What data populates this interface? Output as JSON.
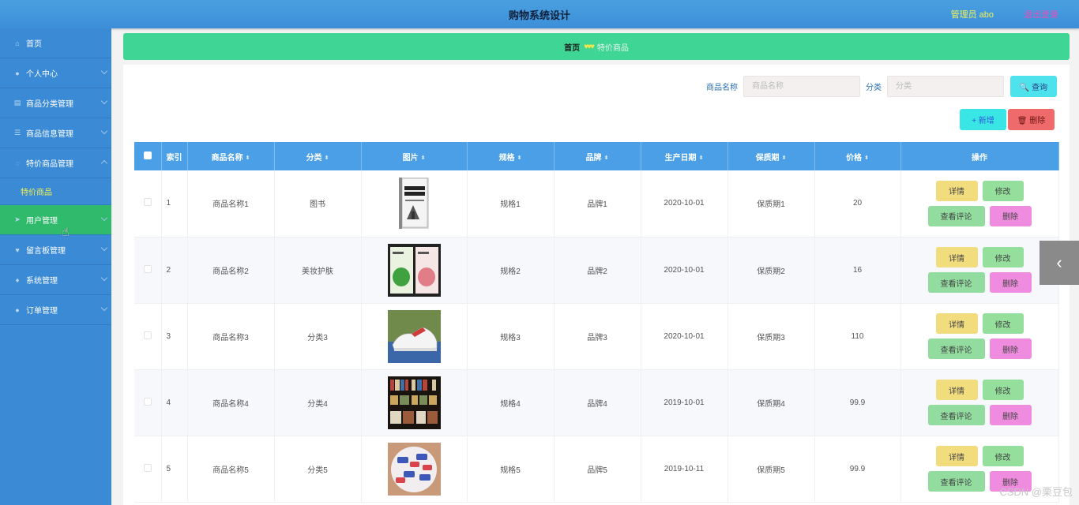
{
  "header": {
    "title": "购物系统设计",
    "user": "管理员 abo",
    "logout": "退出登录"
  },
  "sidebar": {
    "items": [
      {
        "label": "首页",
        "icon": "home-icon",
        "glyph": "⌂"
      },
      {
        "label": "个人中心",
        "icon": "user-icon",
        "glyph": "●"
      },
      {
        "label": "商品分类管理",
        "icon": "clipboard-icon",
        "glyph": "▤"
      },
      {
        "label": "商品信息管理",
        "icon": "list-icon",
        "glyph": "☰"
      },
      {
        "label": "特价商品管理",
        "icon": "settings-icon",
        "glyph": "◌"
      },
      {
        "label": "用户管理",
        "icon": "send-icon",
        "glyph": "➤"
      },
      {
        "label": "留言板管理",
        "icon": "heart-icon",
        "glyph": "♥"
      },
      {
        "label": "系统管理",
        "icon": "mic-icon",
        "glyph": "♦"
      },
      {
        "label": "订单管理",
        "icon": "location-icon",
        "glyph": "●"
      }
    ],
    "submenu": "特价商品"
  },
  "breadcrumb": {
    "home": "首页",
    "separator": "♥♥♥",
    "current": "特价商品"
  },
  "search": {
    "name_label": "商品名称",
    "name_placeholder": "商品名称",
    "category_label": "分类",
    "category_placeholder": "分类",
    "query_button": "🔍 查询"
  },
  "actions": {
    "add": "+ 新增",
    "delete": "🗑 删除"
  },
  "table": {
    "headers": [
      "索引",
      "商品名称",
      "分类",
      "图片",
      "规格",
      "品牌",
      "生产日期",
      "保质期",
      "价格",
      "操作"
    ],
    "rows": [
      {
        "index": "1",
        "name": "商品名称1",
        "category": "图书",
        "spec": "规格1",
        "brand": "品牌1",
        "date": "2020-10-01",
        "shelf": "保质期1",
        "price": "20",
        "image": "book-cover"
      },
      {
        "index": "2",
        "name": "商品名称2",
        "category": "美妆护肤",
        "spec": "规格2",
        "brand": "品牌2",
        "date": "2020-10-01",
        "shelf": "保质期2",
        "price": "16",
        "image": "face-masks"
      },
      {
        "index": "3",
        "name": "商品名称3",
        "category": "分类3",
        "spec": "规格3",
        "brand": "品牌3",
        "date": "2020-10-01",
        "shelf": "保质期3",
        "price": "110",
        "image": "sneakers"
      },
      {
        "index": "4",
        "name": "商品名称4",
        "category": "分类4",
        "spec": "规格4",
        "brand": "品牌4",
        "date": "2019-10-01",
        "shelf": "保质期4",
        "price": "99.9",
        "image": "bookshelf"
      },
      {
        "index": "5",
        "name": "商品名称5",
        "category": "分类5",
        "spec": "规格5",
        "brand": "品牌5",
        "date": "2019-10-11",
        "shelf": "保质期5",
        "price": "99.9",
        "image": "candies"
      }
    ],
    "ops": {
      "detail": "详情",
      "edit": "修改",
      "review": "查看评论",
      "delete": "删除"
    }
  },
  "watermark": "CSDN @栗豆包",
  "colors": {
    "header": "#4a9fe0",
    "sidebar": "#3a8ad6",
    "active": "#2fba6c",
    "breadcrumb": "#3fd594",
    "table_header": "#4a9fe6"
  }
}
